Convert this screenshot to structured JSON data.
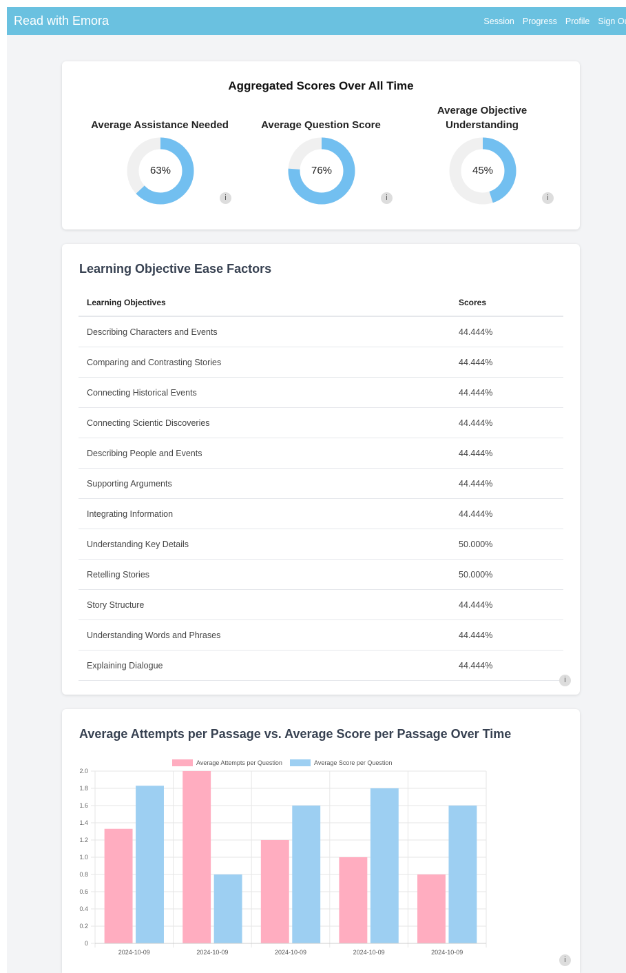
{
  "navbar": {
    "brand": "Read with Emora",
    "links": [
      "Session",
      "Progress",
      "Profile",
      "Sign Out"
    ]
  },
  "aggregated": {
    "title": "Aggregated Scores Over All Time",
    "gauges": [
      {
        "label": "Average Assistance Needed",
        "value": 63,
        "display": "63%"
      },
      {
        "label": "Average Question Score",
        "value": 76,
        "display": "76%"
      },
      {
        "label": "Average Objective Understanding",
        "value": 45,
        "display": "45%"
      }
    ],
    "info_icon": "i"
  },
  "ease_factors": {
    "title": "Learning Objective Ease Factors",
    "columns": [
      "Learning Objectives",
      "Scores"
    ],
    "rows": [
      [
        "Describing Characters and Events",
        "44.444%"
      ],
      [
        "Comparing and Contrasting Stories",
        "44.444%"
      ],
      [
        "Connecting Historical Events",
        "44.444%"
      ],
      [
        "Connecting Scientic Discoveries",
        "44.444%"
      ],
      [
        "Describing People and Events",
        "44.444%"
      ],
      [
        "Supporting Arguments",
        "44.444%"
      ],
      [
        "Integrating Information",
        "44.444%"
      ],
      [
        "Understanding Key Details",
        "50.000%"
      ],
      [
        "Retelling Stories",
        "50.000%"
      ],
      [
        "Story Structure",
        "44.444%"
      ],
      [
        "Understanding Words and Phrases",
        "44.444%"
      ],
      [
        "Explaining Dialogue",
        "44.444%"
      ]
    ]
  },
  "attempts_chart": {
    "title": "Average Attempts per Passage vs. Average Score per Passage Over Time"
  },
  "colors": {
    "navbar": "#6ac1e0",
    "gauge_fill": "#72bff0",
    "gauge_track": "#f0f0f0",
    "series_attempts": "#ffadc0",
    "series_score": "#9dcff2"
  },
  "chart_data": {
    "type": "bar",
    "categories": [
      "2024-10-09",
      "2024-10-09",
      "2024-10-09",
      "2024-10-09",
      "2024-10-09"
    ],
    "series": [
      {
        "name": "Average Attempts per Question",
        "values": [
          1.33,
          2.0,
          1.2,
          1.0,
          0.8
        ]
      },
      {
        "name": "Average Score per Question",
        "values": [
          1.83,
          0.8,
          1.6,
          1.8,
          1.6
        ]
      }
    ],
    "ylim": [
      0,
      2.0
    ],
    "yticks": [
      "0",
      "0.2",
      "0.4",
      "0.6",
      "0.8",
      "1.0",
      "1.2",
      "1.4",
      "1.6",
      "1.8",
      "2.0"
    ],
    "grid": true,
    "legend": "top"
  }
}
